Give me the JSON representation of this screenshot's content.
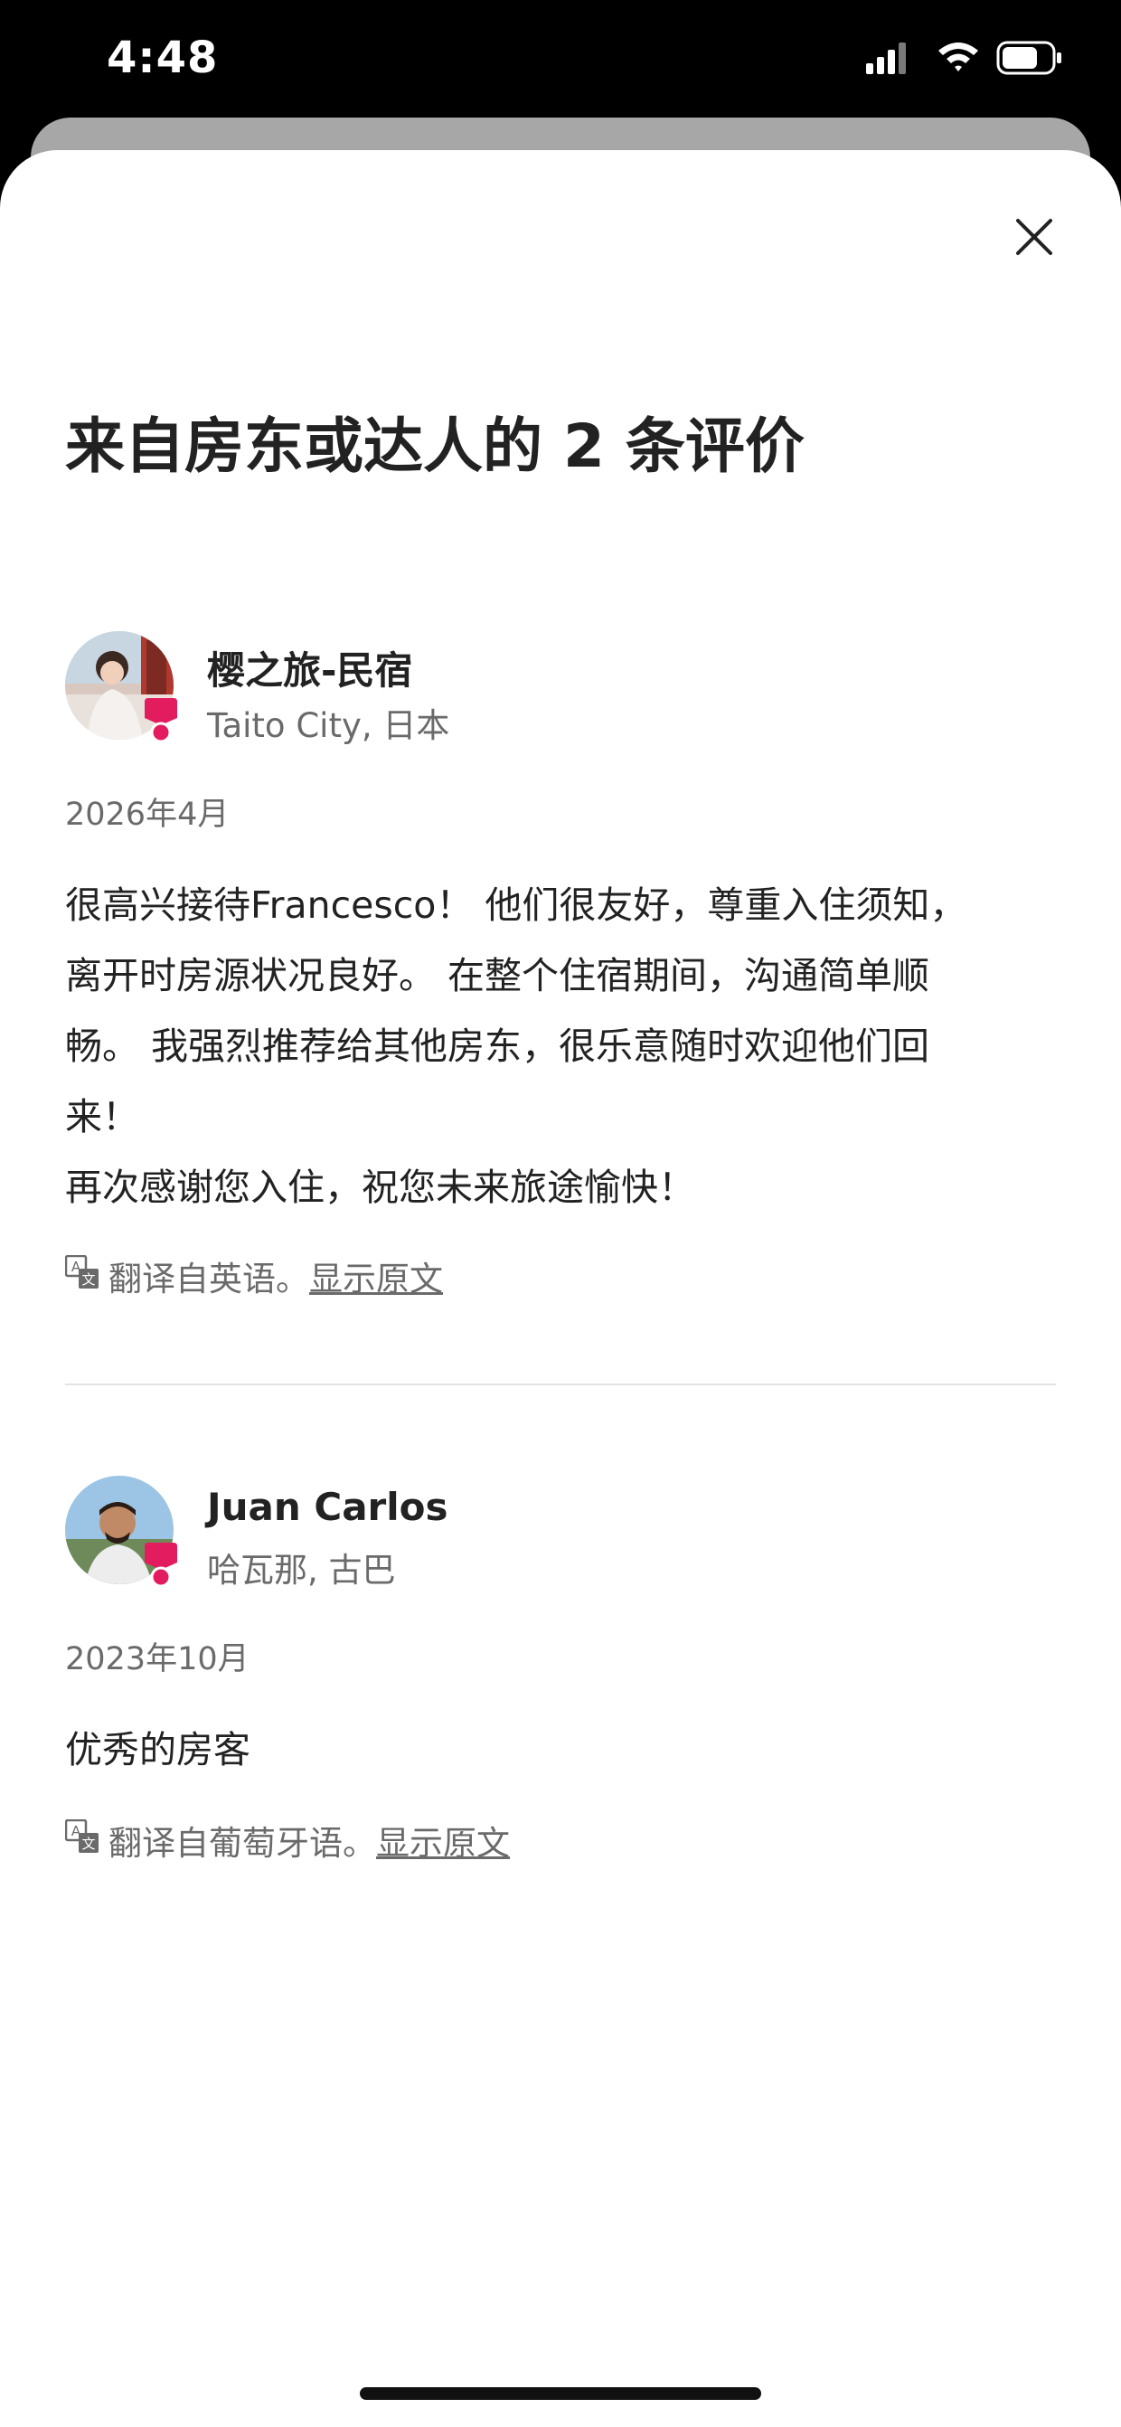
{
  "status_bar": {
    "time": "4:48"
  },
  "header": {
    "title": "来自房东或达人的 2 条评价",
    "close_icon": "close-icon"
  },
  "reviews": [
    {
      "name": "樱之旅-民宿",
      "location": "Taito City, 日本",
      "date": "2026年4月",
      "text_lines": [
        "很高兴接待Francesco！ 他们很友好，尊重入住须知，",
        "离开时房源状况良好。 在整个住宿期间，沟通简单顺",
        "畅。 我强烈推荐给其他房东，很乐意随时欢迎他们回",
        "来！",
        "再次感谢您入住，祝您未来旅途愉快！"
      ],
      "translated_note": "翻译自英语。",
      "show_original": "显示原文"
    },
    {
      "name": "Juan Carlos",
      "location": "哈瓦那, 古巴",
      "date": "2023年10月",
      "text_lines": [
        "优秀的房客"
      ],
      "translated_note": "翻译自葡萄牙语。",
      "show_original": "显示原文"
    }
  ],
  "colors": {
    "accent": "#E31C5F",
    "text_primary": "#222222",
    "text_secondary": "#6A6A6A",
    "divider": "#E4E4E4"
  }
}
